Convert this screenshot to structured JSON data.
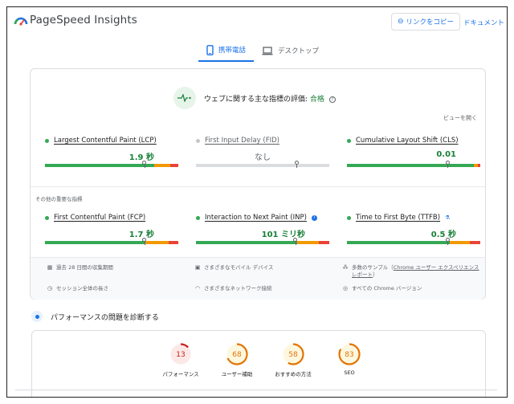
{
  "header": {
    "app_title": "PageSpeed Insights",
    "copy_link_label": "リンクをコピー",
    "docs_label": "ドキュメント"
  },
  "tabs": [
    {
      "label": "携帯電話",
      "active": true,
      "icon": "phone-icon"
    },
    {
      "label": "デスクトップ",
      "active": false,
      "icon": "laptop-icon"
    }
  ],
  "assessment": {
    "prefix": "ウェブに関する主な指標の評価:",
    "status": "合格",
    "expand_label": "ビューを開く"
  },
  "core_metrics": [
    {
      "name": "Largest Contentful Paint (LCP)",
      "value": "1.9 秒",
      "status": "good"
    },
    {
      "name": "First Input Delay (FID)",
      "value": "なし",
      "status": "na"
    },
    {
      "name": "Cumulative Layout Shift (CLS)",
      "value": "0.01",
      "status": "good"
    }
  ],
  "other_metrics_label": "その他の重要な指標",
  "other_metrics": [
    {
      "name": "First Contentful Paint (FCP)",
      "value": "1.7 秒",
      "status": "good"
    },
    {
      "name": "Interaction to Next Paint (INP)",
      "value": "101 ミリ秒",
      "status": "good",
      "badge": "info-icon"
    },
    {
      "name": "Time to First Byte (TTFB)",
      "value": "0.5 秒",
      "status": "good",
      "badge": "flask-icon"
    }
  ],
  "footer": {
    "collection_period": "過去 28 日間の収集期間",
    "devices": "さまざまなモバイル デバイス",
    "samples_prefix": "多数のサンプル（",
    "samples_link": "Chrome ユーザー エクスペリエンス レポート",
    "samples_suffix": "）",
    "session": "セッション全体の長さ",
    "network": "さまざまなネットワーク接続",
    "chrome_versions": "すべての Chrome バージョン"
  },
  "diagnose_title": "パフォーマンスの問題を診断する",
  "scores": [
    {
      "label": "パフォーマンス",
      "score": 13,
      "color": "#c5221f",
      "fill": "#fce8e6"
    },
    {
      "label": "ユーザー補助",
      "score": 68,
      "color": "#e37400",
      "fill": "#fef7e0"
    },
    {
      "label": "おすすめの方法",
      "score": 58,
      "color": "#e37400",
      "fill": "#fef7e0"
    },
    {
      "label": "SEO",
      "score": 83,
      "color": "#e37400",
      "fill": "#fef7e0"
    }
  ],
  "colors": {
    "accent": "#1a73e8",
    "good": "#34a853",
    "needs_improvement": "#f29900",
    "poor": "#ea4335"
  }
}
